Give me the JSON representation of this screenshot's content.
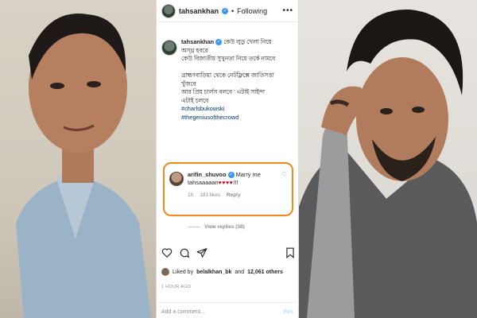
{
  "post": {
    "username": "tahsankhan",
    "following": "Following",
    "dot": "•",
    "more": "•••",
    "caption_lines": [
      "কেউ লুডু খেলা নিয়ে",
      "অস্থ্র হবরে",
      "কেউ বিজাতীয় সুখুনতা নিয়ে তর্কে নামবে",
      "",
      "ব্রাহ্মণবাড়িয়া থেকে নেটফ্লিক্সে জাতিসত্তা",
      "খুঁজবে",
      "আর প্রিয় চার্লস বলবে ' এটাই সাইন্দ'",
      "এটাই চলবে"
    ],
    "hashtags": [
      "#charlsbukowski",
      "#thegeniusofthecrowd"
    ]
  },
  "comment": {
    "username": "arifin_shuvoo",
    "text_line1": "Marry me",
    "text_line2": "tahsaaaaan",
    "hearts": "♥♥♥♥",
    "tail": "!!!",
    "time": "1h",
    "likes": "181 likes",
    "reply": "Reply",
    "view_replies": "View replies (38)"
  },
  "footer": {
    "liked_by_prefix": "Liked by",
    "liked_by_user": "belalkhan_bk",
    "and": "and",
    "others": "12,061 others",
    "timestamp": "1 HOUR AGO",
    "add_comment": "Add a comment...",
    "post": "Pos"
  }
}
